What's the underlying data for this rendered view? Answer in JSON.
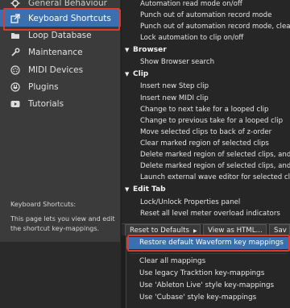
{
  "sidebar": {
    "items": [
      {
        "label": "General Behaviour",
        "icon": "gear-icon"
      },
      {
        "label": "Keyboard Shortcuts",
        "icon": "external-link-icon"
      },
      {
        "label": "Loop Database",
        "icon": "folder-icon"
      },
      {
        "label": "Maintenance",
        "icon": "wrench-icon"
      },
      {
        "label": "MIDI Devices",
        "icon": "midi-port-icon"
      },
      {
        "label": "Plugins",
        "icon": "plug-icon"
      },
      {
        "label": "Tutorials",
        "icon": "play-icon"
      }
    ],
    "description_title": "Keyboard Shortcuts:",
    "description_body": "This page lets you view and edit the shortcut key-mappings."
  },
  "shortcuts": {
    "rows": [
      {
        "type": "cmd",
        "label": "Automation read mode on/off"
      },
      {
        "type": "cmd",
        "label": "Punch out of automation record mode"
      },
      {
        "type": "cmd",
        "label": "Punch out of automation record mode, clearing"
      },
      {
        "type": "cmd",
        "label": "Lock automation to clip on/off"
      },
      {
        "type": "cat",
        "label": "Browser"
      },
      {
        "type": "cmd",
        "label": "Show Browser search"
      },
      {
        "type": "cat",
        "label": "Clip"
      },
      {
        "type": "cmd",
        "label": "Insert new Step clip"
      },
      {
        "type": "cmd",
        "label": "Insert new MIDI clip"
      },
      {
        "type": "cmd",
        "label": "Change to next take for a looped clip"
      },
      {
        "type": "cmd",
        "label": "Change to previous take for a looped clip"
      },
      {
        "type": "cmd",
        "label": "Move selected clips to back of z-order"
      },
      {
        "type": "cmd",
        "label": "Clear marked region of selected clips"
      },
      {
        "type": "cmd",
        "label": "Delete marked region of selected clips, and m"
      },
      {
        "type": "cmd",
        "label": "Delete marked region of selected clips, and m"
      },
      {
        "type": "cmd",
        "label": "Launch external wave editor for selected clip"
      },
      {
        "type": "cat",
        "label": "Edit Tab"
      },
      {
        "type": "cmd",
        "label": "Lock/Unlock Properties panel"
      },
      {
        "type": "cmd",
        "label": "Reset all level meter overload indicators"
      }
    ]
  },
  "buttons": {
    "reset_label": "Reset to Defaults",
    "view_html_label": "View as HTML...",
    "save_label": "Sav"
  },
  "menu": {
    "items": [
      "Restore default Waveform key mappings",
      "Clear all mappings",
      "Use legacy Tracktion key-mappings",
      "Use 'Ableton Live' style key-mappings",
      "Use 'Cubase' style key-mappings"
    ]
  },
  "colors": {
    "selection_blue": "#3a6fb0",
    "highlight_outline_red": "#e23a2a"
  }
}
